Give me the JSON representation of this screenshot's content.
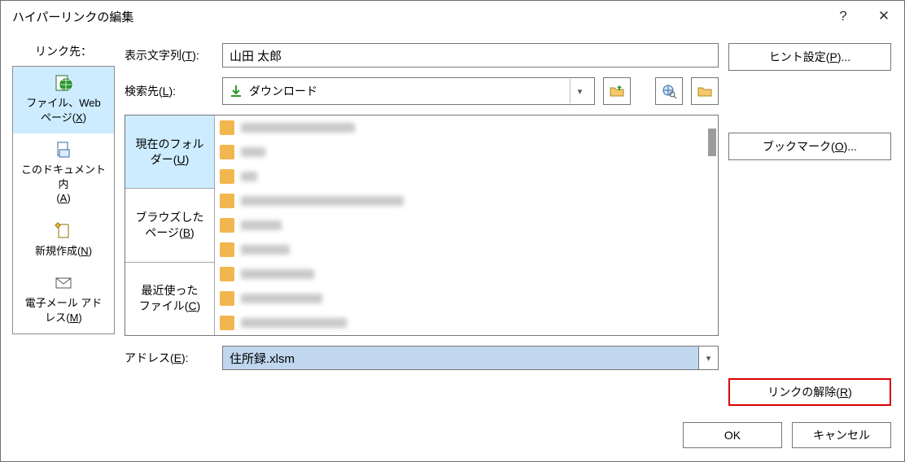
{
  "title": "ハイパーリンクの編集",
  "help_symbol": "?",
  "close_symbol": "✕",
  "linkto_label": "リンク先：",
  "link_items": [
    {
      "label_line1": "ファイル、Web",
      "label_line2_pre": "ページ(",
      "hotkey": "X",
      "label_line2_post": ")"
    },
    {
      "label_line1": "このドキュメント内",
      "label_line2_pre": "(",
      "hotkey": "A",
      "label_line2_post": ")"
    },
    {
      "label_line1_pre": "新規作成(",
      "hotkey": "N",
      "label_line1_post": ")"
    },
    {
      "label_line1": "電子メール アド",
      "label_line2_pre": "レス(",
      "hotkey": "M",
      "label_line2_post": ")"
    }
  ],
  "display_text": {
    "label_pre": "表示文字列(",
    "hotkey": "T",
    "label_post": "):",
    "value": "山田 太郎"
  },
  "lookin": {
    "label_pre": "検索先(",
    "hotkey": "L",
    "label_post": "):",
    "value": "ダウンロード"
  },
  "tabs": [
    {
      "line1": "現在のフォル",
      "line2_pre": "ダー(",
      "hotkey": "U",
      "line2_post": ")"
    },
    {
      "line1": "ブラウズした",
      "line2_pre": "ページ(",
      "hotkey": "B",
      "line2_post": ")"
    },
    {
      "line1": "最近使った",
      "line2_pre": "ファイル(",
      "hotkey": "C",
      "line2_post": ")"
    }
  ],
  "address": {
    "label_pre": "アドレス(",
    "hotkey": "E",
    "label_post": "):",
    "value": "住所録.xlsm"
  },
  "right_buttons": {
    "screentip": {
      "pre": "ヒント設定(",
      "hotkey": "P",
      "post": ")..."
    },
    "bookmark": {
      "pre": "ブックマーク(",
      "hotkey": "O",
      "post": ")..."
    },
    "remove_link": {
      "pre": "リンクの解除(",
      "hotkey": "R",
      "post": ")"
    }
  },
  "footer": {
    "ok": "OK",
    "cancel": "キャンセル"
  }
}
